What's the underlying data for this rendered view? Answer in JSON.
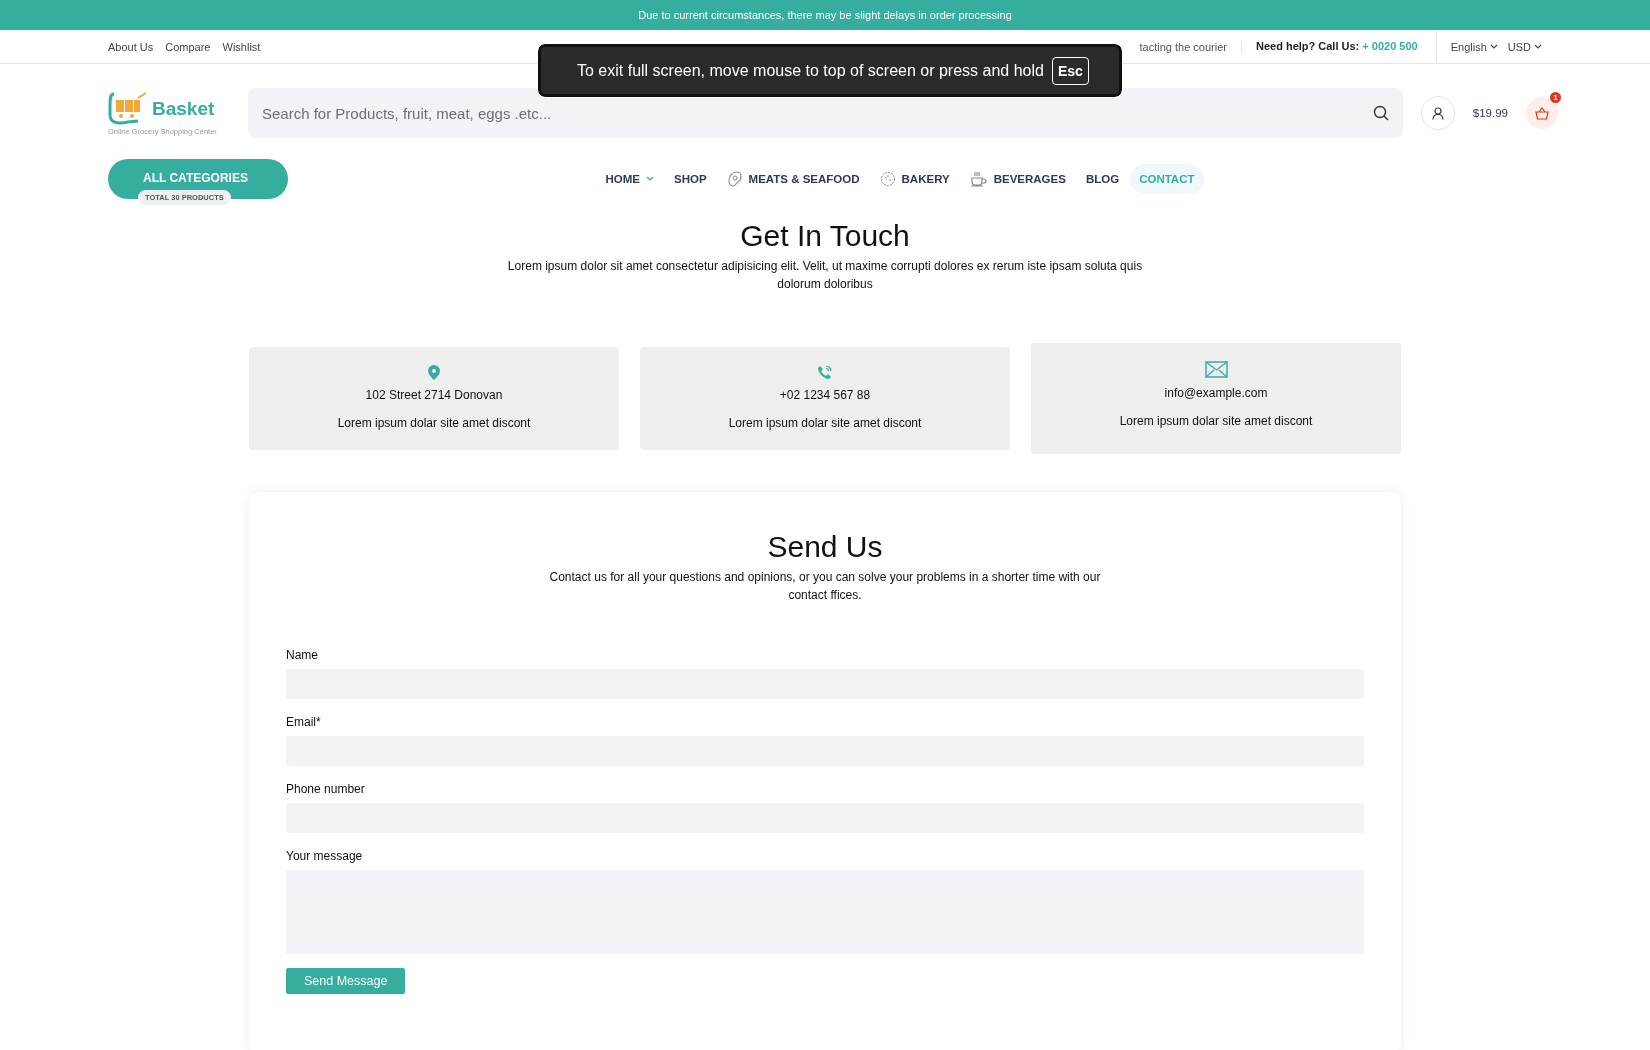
{
  "announcement": "Due to current circumstances, there may be slight delays in order processing",
  "top_links": [
    "About Us",
    "Compare",
    "Wishlist"
  ],
  "top_note": "tacting the courier",
  "help": {
    "label": "Need help? Call Us:",
    "phone": "+ 0020 500"
  },
  "selectors": [
    "English",
    "USD"
  ],
  "logo": {
    "name": "Basket",
    "tagline": "Online Grocery Shopping Center"
  },
  "search": {
    "placeholder": "Search for Products, fruit, meat, eggs .etc..."
  },
  "cart": {
    "total": "$19.99",
    "count": "1"
  },
  "categories": {
    "label": "ALL CATEGORIES",
    "count": "TOTAL 30 PRODUCTS"
  },
  "nav": [
    {
      "label": "HOME",
      "kind": "dropdown",
      "selected": false
    },
    {
      "label": "SHOP",
      "kind": "plain",
      "selected": false
    },
    {
      "label": "MEATS & SEAFOOD",
      "kind": "steak",
      "selected": false
    },
    {
      "label": "BAKERY",
      "kind": "cookie",
      "selected": false
    },
    {
      "label": "BEVERAGES",
      "kind": "cup",
      "selected": false
    },
    {
      "label": "BLOG",
      "kind": "plain",
      "selected": false
    },
    {
      "label": "CONTACT",
      "kind": "plain",
      "selected": true
    }
  ],
  "intro": {
    "title": "Get In Touch",
    "text": "Lorem ipsum dolor sit amet consectetur adipisicing elit. Velit, ut maxime corrupti dolores ex rerum iste ipsam soluta quis dolorum doloribus"
  },
  "cards": [
    {
      "kind": "pin",
      "title": "102 Street 2714 Donovan",
      "text": "Lorem ipsum dolar site amet discont"
    },
    {
      "kind": "phone",
      "title": "+02 1234 567 88",
      "text": "Lorem ipsum dolar site amet discont"
    },
    {
      "kind": "mail",
      "title": "info@example.com",
      "text": "Lorem ipsum dolar site amet discont"
    }
  ],
  "form": {
    "title": "Send Us",
    "text": "Contact us for all your questions and opinions, or you can solve your problems in a shorter time with our contact ffices.",
    "fields": [
      {
        "label": "Name",
        "kind": "line"
      },
      {
        "label": "Email*",
        "kind": "line"
      },
      {
        "label": "Phone number",
        "kind": "line"
      },
      {
        "label": "Your message",
        "kind": "area"
      }
    ],
    "button": "Send Message"
  },
  "fullscreen_notice": {
    "text": "To exit full screen, move mouse to top of screen or press and hold",
    "key": "Esc"
  }
}
